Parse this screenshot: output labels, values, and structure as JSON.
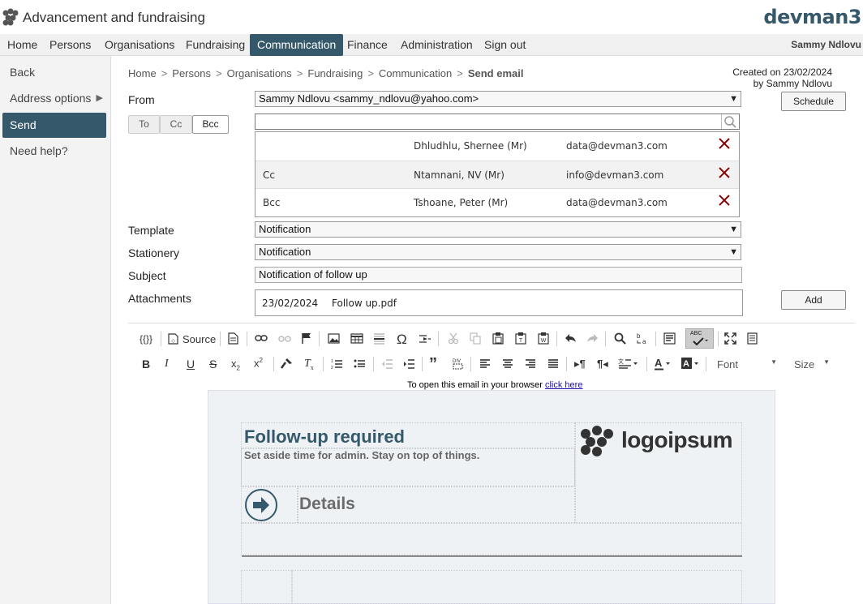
{
  "app": {
    "title": "Advancement and fundraising",
    "brand": "devman3",
    "user": "Sammy Ndlovu"
  },
  "nav": [
    {
      "label": "Home"
    },
    {
      "label": "Persons"
    },
    {
      "label": "Organisations"
    },
    {
      "label": "Fundraising"
    },
    {
      "label": "Communication"
    },
    {
      "label": "Finance"
    },
    {
      "label": "Administration"
    },
    {
      "label": "Sign out"
    }
  ],
  "sidebar": {
    "items": [
      {
        "label": "Back"
      },
      {
        "label": "Address options"
      },
      {
        "label": "Send"
      },
      {
        "label": "Need help?"
      }
    ],
    "arrow": "▶"
  },
  "breadcrumb": {
    "items": [
      "Home",
      "Persons",
      "Organisations",
      "Fundraising",
      "Communication"
    ],
    "current": "Send email",
    "sep": ">"
  },
  "created": {
    "line1": "Created on 23/02/2024",
    "line2": "by Sammy Ndlovu"
  },
  "form": {
    "from_label": "From",
    "from_value": "Sammy Ndlovu <sammy_ndlovu@yahoo.com>",
    "schedule_label": "Schedule",
    "tabs": [
      "To",
      "Cc",
      "Bcc"
    ],
    "recipients": [
      {
        "type": "",
        "name": "Dhludhlu, Shernee (Mr)",
        "email": "data@devman3.com"
      },
      {
        "type": "Cc",
        "name": "Ntamnani, NV (Mr)",
        "email": "info@devman3.com"
      },
      {
        "type": "Bcc",
        "name": "Tshoane, Peter (Mr)",
        "email": "data@devman3.com"
      }
    ],
    "template_label": "Template",
    "template_value": "Notification",
    "stationery_label": "Stationery",
    "stationery_value": "Notification",
    "subject_label": "Subject",
    "subject_value": "Notification of follow up",
    "attachments_label": "Attachments",
    "attachment_date": "23/02/2024",
    "attachment_file": "Follow up.pdf",
    "add_label": "Add"
  },
  "toolbar": {
    "placeholder_icon": "{{}}",
    "source_label": "Source",
    "font_label": "Font",
    "size_label": "Size",
    "omega": "Ω",
    "abc": "ABC"
  },
  "email": {
    "open_note": "To open this email in your browser",
    "open_link": "click here",
    "title": "Follow-up required",
    "subtitle": "Set aside time for admin. Stay on top of things.",
    "details": "Details",
    "logo_text": "logoipsum"
  },
  "colors": {
    "accent": "#35596b",
    "delete": "#8b0000"
  }
}
